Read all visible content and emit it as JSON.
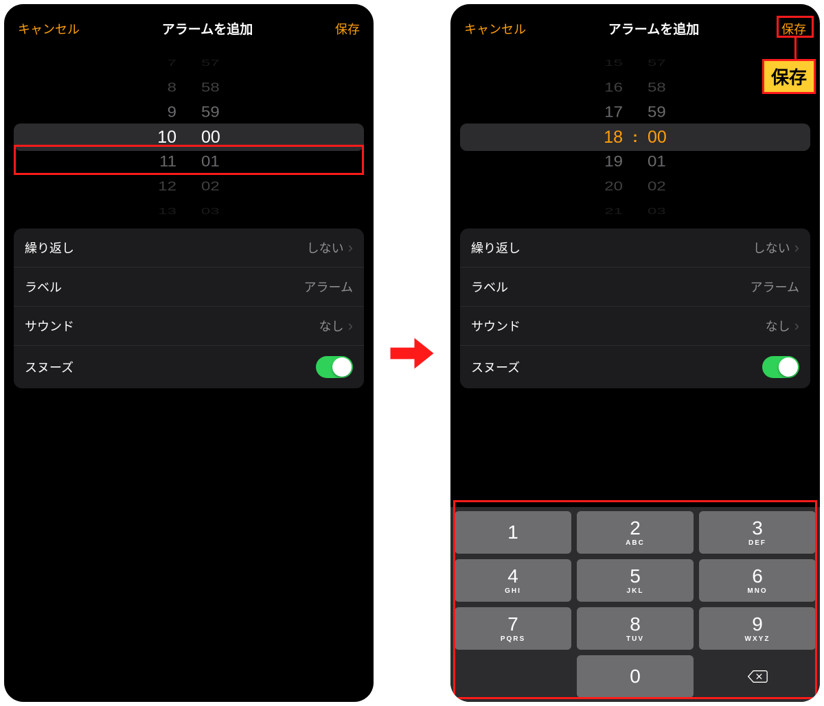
{
  "panels": {
    "left": {
      "nav": {
        "cancel": "キャンセル",
        "title": "アラームを追加",
        "save": "保存"
      },
      "picker_style": "plain",
      "hours": [
        "7",
        "8",
        "9",
        "10",
        "11",
        "12",
        "13"
      ],
      "minutes": [
        "57",
        "58",
        "59",
        "00",
        "01",
        "02",
        "03"
      ],
      "settings": {
        "repeat": {
          "label": "繰り返し",
          "value": "しない"
        },
        "label_row": {
          "label": "ラベル",
          "value": "アラーム"
        },
        "sound": {
          "label": "サウンド",
          "value": "なし"
        },
        "snooze": {
          "label": "スヌーズ",
          "on": true
        }
      }
    },
    "right": {
      "nav": {
        "cancel": "キャンセル",
        "title": "アラームを追加",
        "save": "保存"
      },
      "picker_style": "editable",
      "colon": ":",
      "hours": [
        "15",
        "16",
        "17",
        "18",
        "19",
        "20",
        "21"
      ],
      "minutes": [
        "57",
        "58",
        "59",
        "00",
        "01",
        "02",
        "03"
      ],
      "settings": {
        "repeat": {
          "label": "繰り返し",
          "value": "しない"
        },
        "label_row": {
          "label": "ラベル",
          "value": "アラーム"
        },
        "sound": {
          "label": "サウンド",
          "value": "なし"
        },
        "snooze": {
          "label": "スヌーズ",
          "on": true
        }
      },
      "keypad": [
        {
          "d": "1",
          "l": ""
        },
        {
          "d": "2",
          "l": "ABC"
        },
        {
          "d": "3",
          "l": "DEF"
        },
        {
          "d": "4",
          "l": "GHI"
        },
        {
          "d": "5",
          "l": "JKL"
        },
        {
          "d": "6",
          "l": "MNO"
        },
        {
          "d": "7",
          "l": "PQRS"
        },
        {
          "d": "8",
          "l": "TUV"
        },
        {
          "d": "9",
          "l": "WXYZ"
        },
        {
          "d": "",
          "l": ""
        },
        {
          "d": "0",
          "l": ""
        },
        {
          "d": "del",
          "l": ""
        }
      ],
      "callout_text": "保存"
    }
  }
}
